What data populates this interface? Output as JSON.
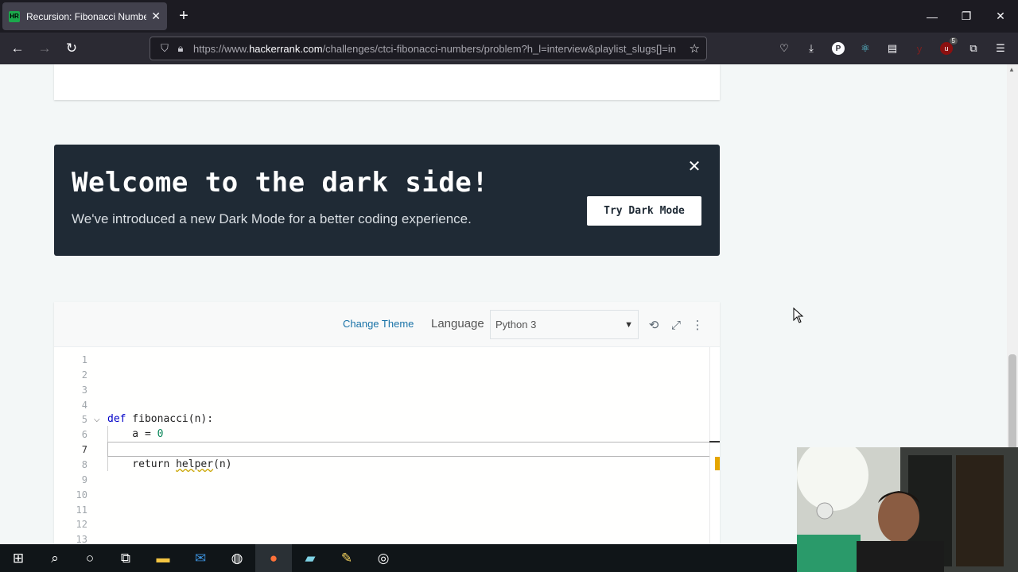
{
  "browser": {
    "tab_title": "Recursion: Fibonacci Numbers |",
    "tab_favicon_text": "HR",
    "url_prefix": "https://www.",
    "url_domain": "hackerrank.com",
    "url_rest": "/challenges/ctci-fibonacci-numbers/problem?h_l=interview&playlist_slugs[]=in",
    "extension_badge_count": "5",
    "profile_badge": "P"
  },
  "banner": {
    "title": "Welcome to the dark side!",
    "subtitle": "We've introduced a new Dark Mode for a better coding experience.",
    "button_label": "Try Dark Mode"
  },
  "editor": {
    "change_theme_label": "Change Theme",
    "language_label": "Language",
    "language_value": "Python 3",
    "active_line": 7,
    "lines": [
      {
        "num": "1"
      },
      {
        "num": "2"
      },
      {
        "num": "3"
      },
      {
        "num": "4"
      },
      {
        "num": "5"
      },
      {
        "num": "6"
      },
      {
        "num": "7"
      },
      {
        "num": "8"
      },
      {
        "num": "9"
      },
      {
        "num": "10"
      },
      {
        "num": "11"
      },
      {
        "num": "12"
      },
      {
        "num": "13"
      }
    ],
    "code": {
      "line5_kw": "def",
      "line5_rest": " fibonacci(n):",
      "line6_pre": "    a = ",
      "line6_num": "0",
      "line8_pre": "    return ",
      "line8_fn": "helper",
      "line8_rest": "(n)"
    }
  },
  "colors": {
    "banner_bg": "#1f2a35",
    "link_blue": "#1a73a8",
    "keyword_blue": "#0000c8",
    "number_green": "#098658"
  }
}
